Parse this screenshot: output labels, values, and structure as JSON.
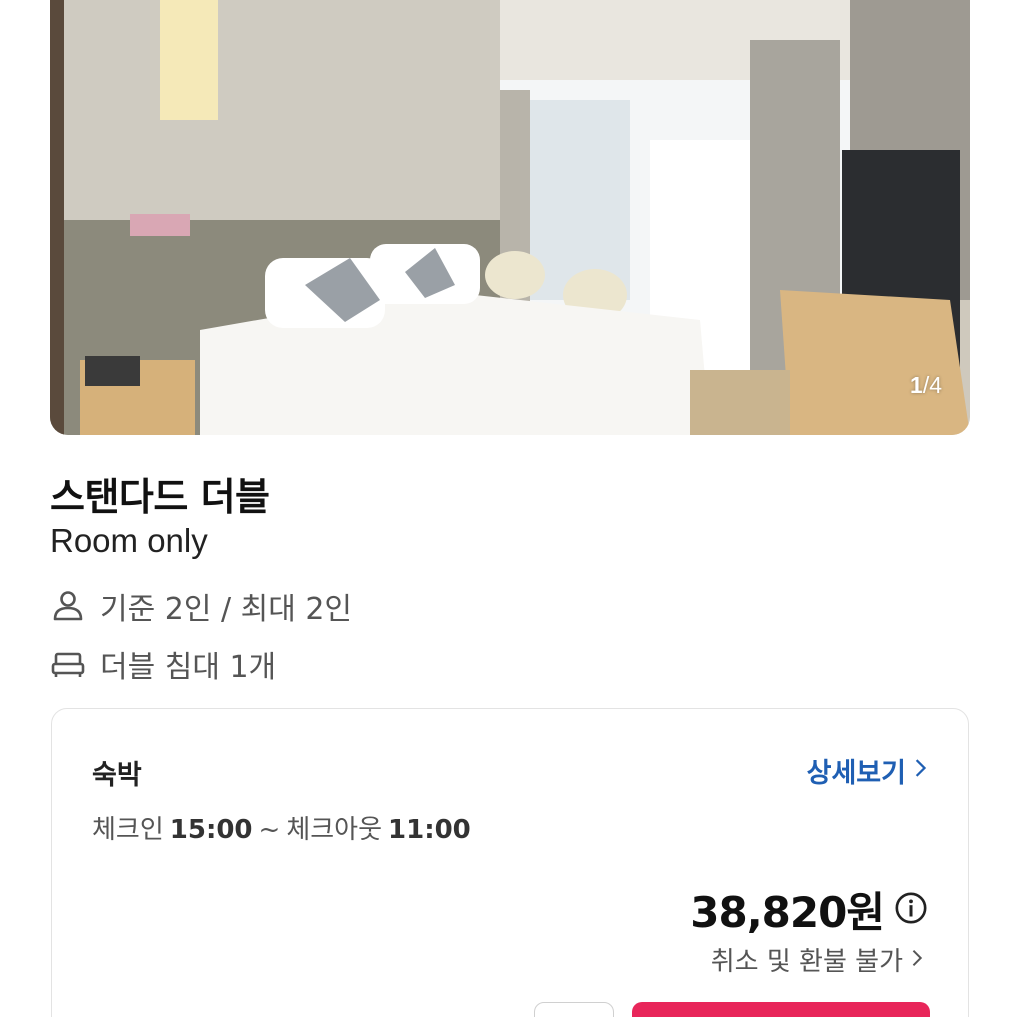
{
  "gallery": {
    "current": "1",
    "separator": "/",
    "total": "4"
  },
  "room": {
    "name": "스탠다드 더블",
    "plan": "Room only",
    "capacity": "기준 2인 / 최대 2인",
    "bed": "더블 침대 1개"
  },
  "stay": {
    "type": "숙박",
    "detail_label": "상세보기",
    "checkin_label": "체크인",
    "checkin_time": "15:00",
    "range_sep": "~",
    "checkout_label": "체크아웃",
    "checkout_time": "11:00",
    "price": "38,820원",
    "refund_policy": "취소 및 환불 불가"
  },
  "colors": {
    "accent": "#1f5fb3",
    "primary_button": "#e8265a"
  },
  "icons": {
    "capacity": "person-icon",
    "bed": "bed-icon",
    "detail": "chevron-right-icon",
    "price_info": "info-icon",
    "refund": "chevron-right-icon"
  }
}
